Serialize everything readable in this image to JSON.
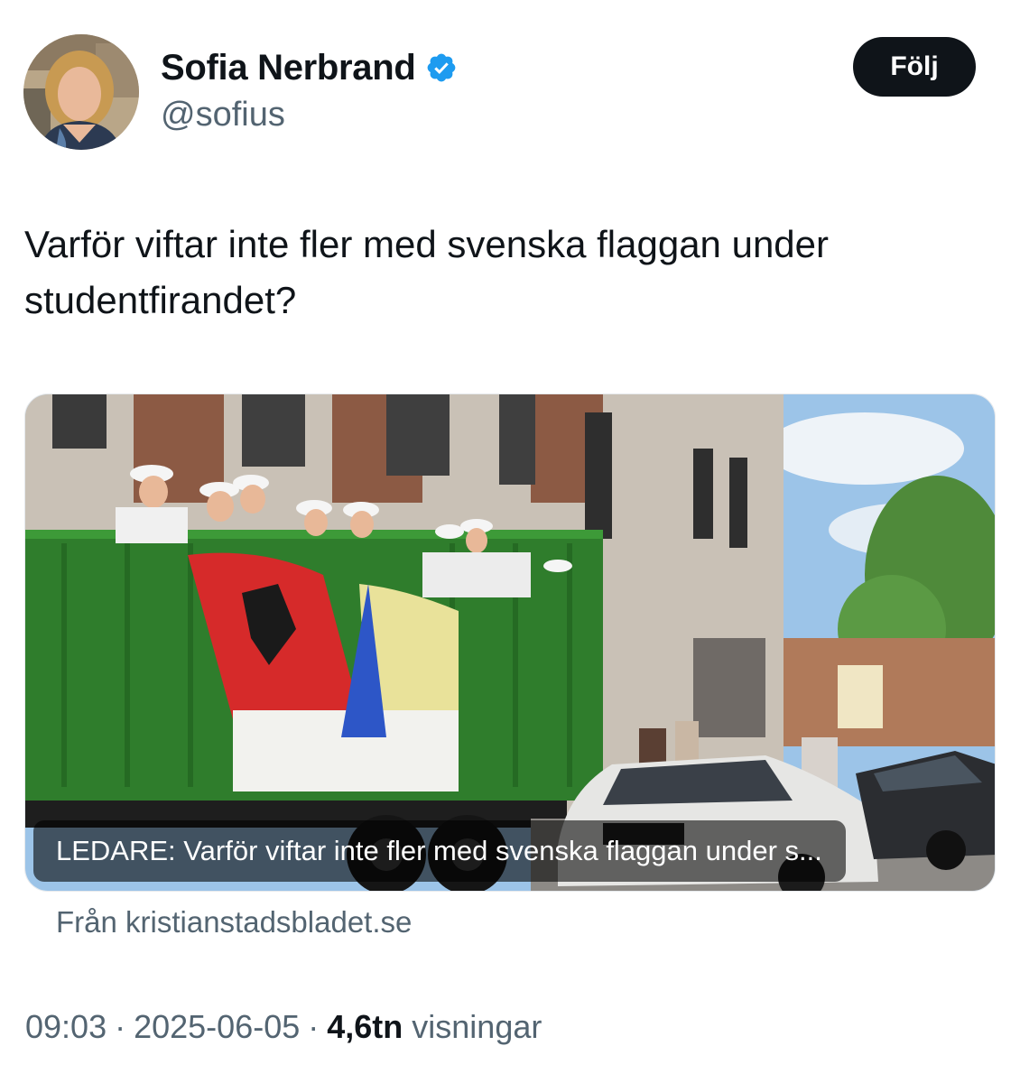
{
  "author": {
    "display_name": "Sofia Nerbrand",
    "handle": "@sofius",
    "verified": true,
    "verified_color": "#1d9bf0"
  },
  "follow_button": {
    "label": "Följ"
  },
  "tweet": {
    "text": "Varför viftar inte fler med svenska flaggan under studentfirandet?"
  },
  "link_card": {
    "caption": "LEDARE: Varför viftar inte fler med svenska flaggan under s...",
    "source": "Från kristianstadsbladet.se"
  },
  "meta": {
    "time": "09:03",
    "separator": "·",
    "date": "2025-06-05",
    "views_count": "4,6tn",
    "views_label": "visningar"
  },
  "colors": {
    "text_primary": "#0f1419",
    "text_secondary": "#536471",
    "button_bg": "#0f1419",
    "accent": "#1d9bf0"
  }
}
